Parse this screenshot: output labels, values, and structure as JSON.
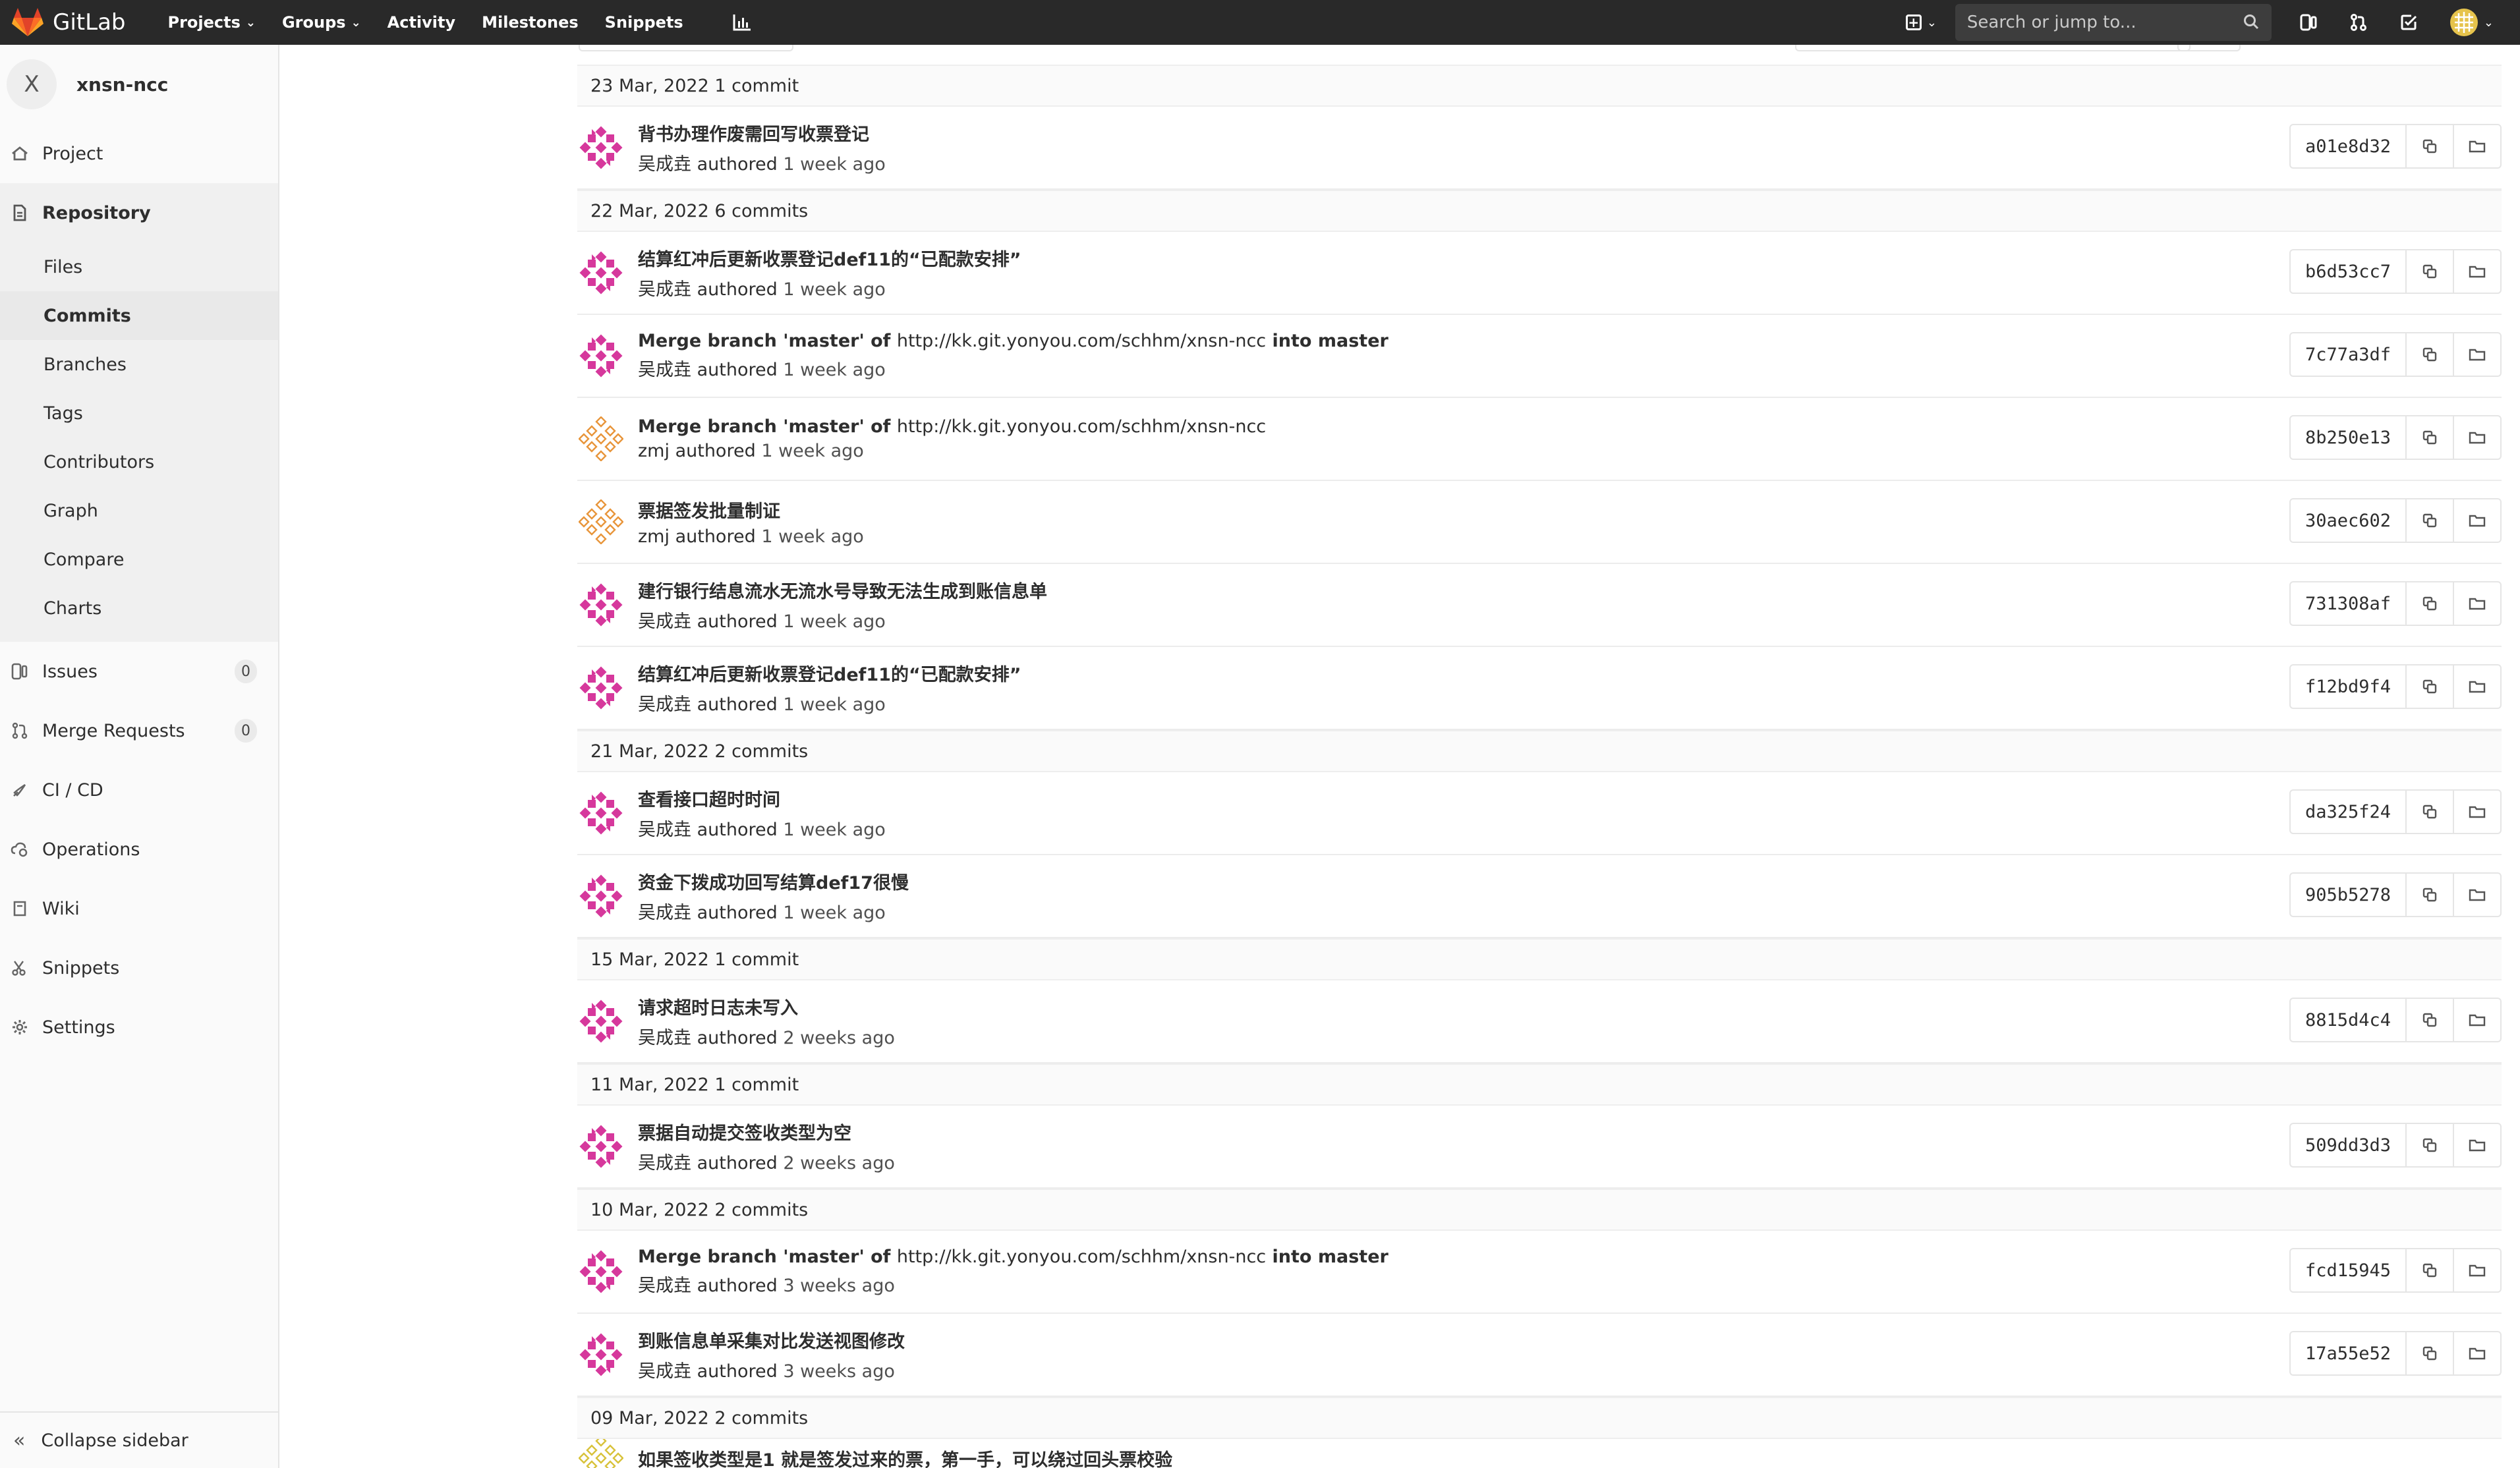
{
  "navbar": {
    "brand": "GitLab",
    "items": [
      {
        "label": "Projects",
        "dropdown": true
      },
      {
        "label": "Groups",
        "dropdown": true
      },
      {
        "label": "Activity",
        "dropdown": false
      },
      {
        "label": "Milestones",
        "dropdown": false
      },
      {
        "label": "Snippets",
        "dropdown": false
      }
    ],
    "search_placeholder": "Search or jump to..."
  },
  "sidebar": {
    "project_letter": "X",
    "project_name": "xnsn-ncc",
    "items": {
      "project": "Project",
      "repository": "Repository",
      "issues": "Issues",
      "issues_count": "0",
      "merge_requests": "Merge Requests",
      "merge_requests_count": "0",
      "cicd": "CI / CD",
      "operations": "Operations",
      "wiki": "Wiki",
      "snippets": "Snippets",
      "settings": "Settings"
    },
    "repository_sub": [
      "Files",
      "Commits",
      "Branches",
      "Tags",
      "Contributors",
      "Graph",
      "Compare",
      "Charts"
    ],
    "active_sub": "Commits",
    "collapse": "Collapse sidebar"
  },
  "days": [
    {
      "header": "23 Mar, 2022 1 commit",
      "commits": [
        {
          "title": "背书办理作废需回写收票登记",
          "url": "",
          "suffix": "",
          "author": "吴成垚",
          "ago": "1 week ago",
          "sha": "a01e8d32",
          "avatar": "pink"
        }
      ]
    },
    {
      "header": "22 Mar, 2022 6 commits",
      "commits": [
        {
          "title": "结算红冲后更新收票登记def11的“已配款安排”",
          "url": "",
          "suffix": "",
          "author": "吴成垚",
          "ago": "1 week ago",
          "sha": "b6d53cc7",
          "avatar": "pink"
        },
        {
          "title": "Merge branch 'master' of ",
          "url": "http://kk.git.yonyou.com/schhm/xnsn-ncc",
          "suffix": " into master",
          "author": "吴成垚",
          "ago": "1 week ago",
          "sha": "7c77a3df",
          "avatar": "pink"
        },
        {
          "title": "Merge branch 'master' of ",
          "url": "http://kk.git.yonyou.com/schhm/xnsn-ncc",
          "suffix": "",
          "author": "zmj",
          "ago": "1 week ago",
          "sha": "8b250e13",
          "avatar": "orange"
        },
        {
          "title": "票据签发批量制证",
          "url": "",
          "suffix": "",
          "author": "zmj",
          "ago": "1 week ago",
          "sha": "30aec602",
          "avatar": "orange"
        },
        {
          "title": "建行银行结息流水无流水号导致无法生成到账信息单",
          "url": "",
          "suffix": "",
          "author": "吴成垚",
          "ago": "1 week ago",
          "sha": "731308af",
          "avatar": "pink"
        },
        {
          "title": "结算红冲后更新收票登记def11的“已配款安排”",
          "url": "",
          "suffix": "",
          "author": "吴成垚",
          "ago": "1 week ago",
          "sha": "f12bd9f4",
          "avatar": "pink"
        }
      ]
    },
    {
      "header": "21 Mar, 2022 2 commits",
      "commits": [
        {
          "title": "查看接口超时时间",
          "url": "",
          "suffix": "",
          "author": "吴成垚",
          "ago": "1 week ago",
          "sha": "da325f24",
          "avatar": "pink"
        },
        {
          "title": "资金下拨成功回写结算def17很慢",
          "url": "",
          "suffix": "",
          "author": "吴成垚",
          "ago": "1 week ago",
          "sha": "905b5278",
          "avatar": "pink"
        }
      ]
    },
    {
      "header": "15 Mar, 2022 1 commit",
      "commits": [
        {
          "title": "请求超时日志未写入",
          "url": "",
          "suffix": "",
          "author": "吴成垚",
          "ago": "2 weeks ago",
          "sha": "8815d4c4",
          "avatar": "pink"
        }
      ]
    },
    {
      "header": "11 Mar, 2022 1 commit",
      "commits": [
        {
          "title": "票据自动提交签收类型为空",
          "url": "",
          "suffix": "",
          "author": "吴成垚",
          "ago": "2 weeks ago",
          "sha": "509dd3d3",
          "avatar": "pink"
        }
      ]
    },
    {
      "header": "10 Mar, 2022 2 commits",
      "commits": [
        {
          "title": "Merge branch 'master' of ",
          "url": "http://kk.git.yonyou.com/schhm/xnsn-ncc",
          "suffix": " into master",
          "author": "吴成垚",
          "ago": "3 weeks ago",
          "sha": "fcd15945",
          "avatar": "pink"
        },
        {
          "title": "到账信息单采集对比发送视图修改",
          "url": "",
          "suffix": "",
          "author": "吴成垚",
          "ago": "3 weeks ago",
          "sha": "17a55e52",
          "avatar": "pink"
        }
      ]
    },
    {
      "header": "09 Mar, 2022 2 commits",
      "commits": [
        {
          "title": "如果签收类型是1 就是签发过来的票，第一手，可以绕过回头票校验",
          "url": "",
          "suffix": "",
          "author": "",
          "ago": "",
          "sha": "",
          "avatar": "yellow",
          "partial": true
        }
      ]
    }
  ],
  "labels": {
    "authored": "authored"
  },
  "colors": {
    "navbar_bg": "#292929",
    "avatar_pink": "#d6389c",
    "avatar_orange": "#e8953a",
    "avatar_yellow": "#d8c23a"
  },
  "icons": {
    "copy_sha": "copy-icon",
    "browse_files": "folder-icon"
  }
}
